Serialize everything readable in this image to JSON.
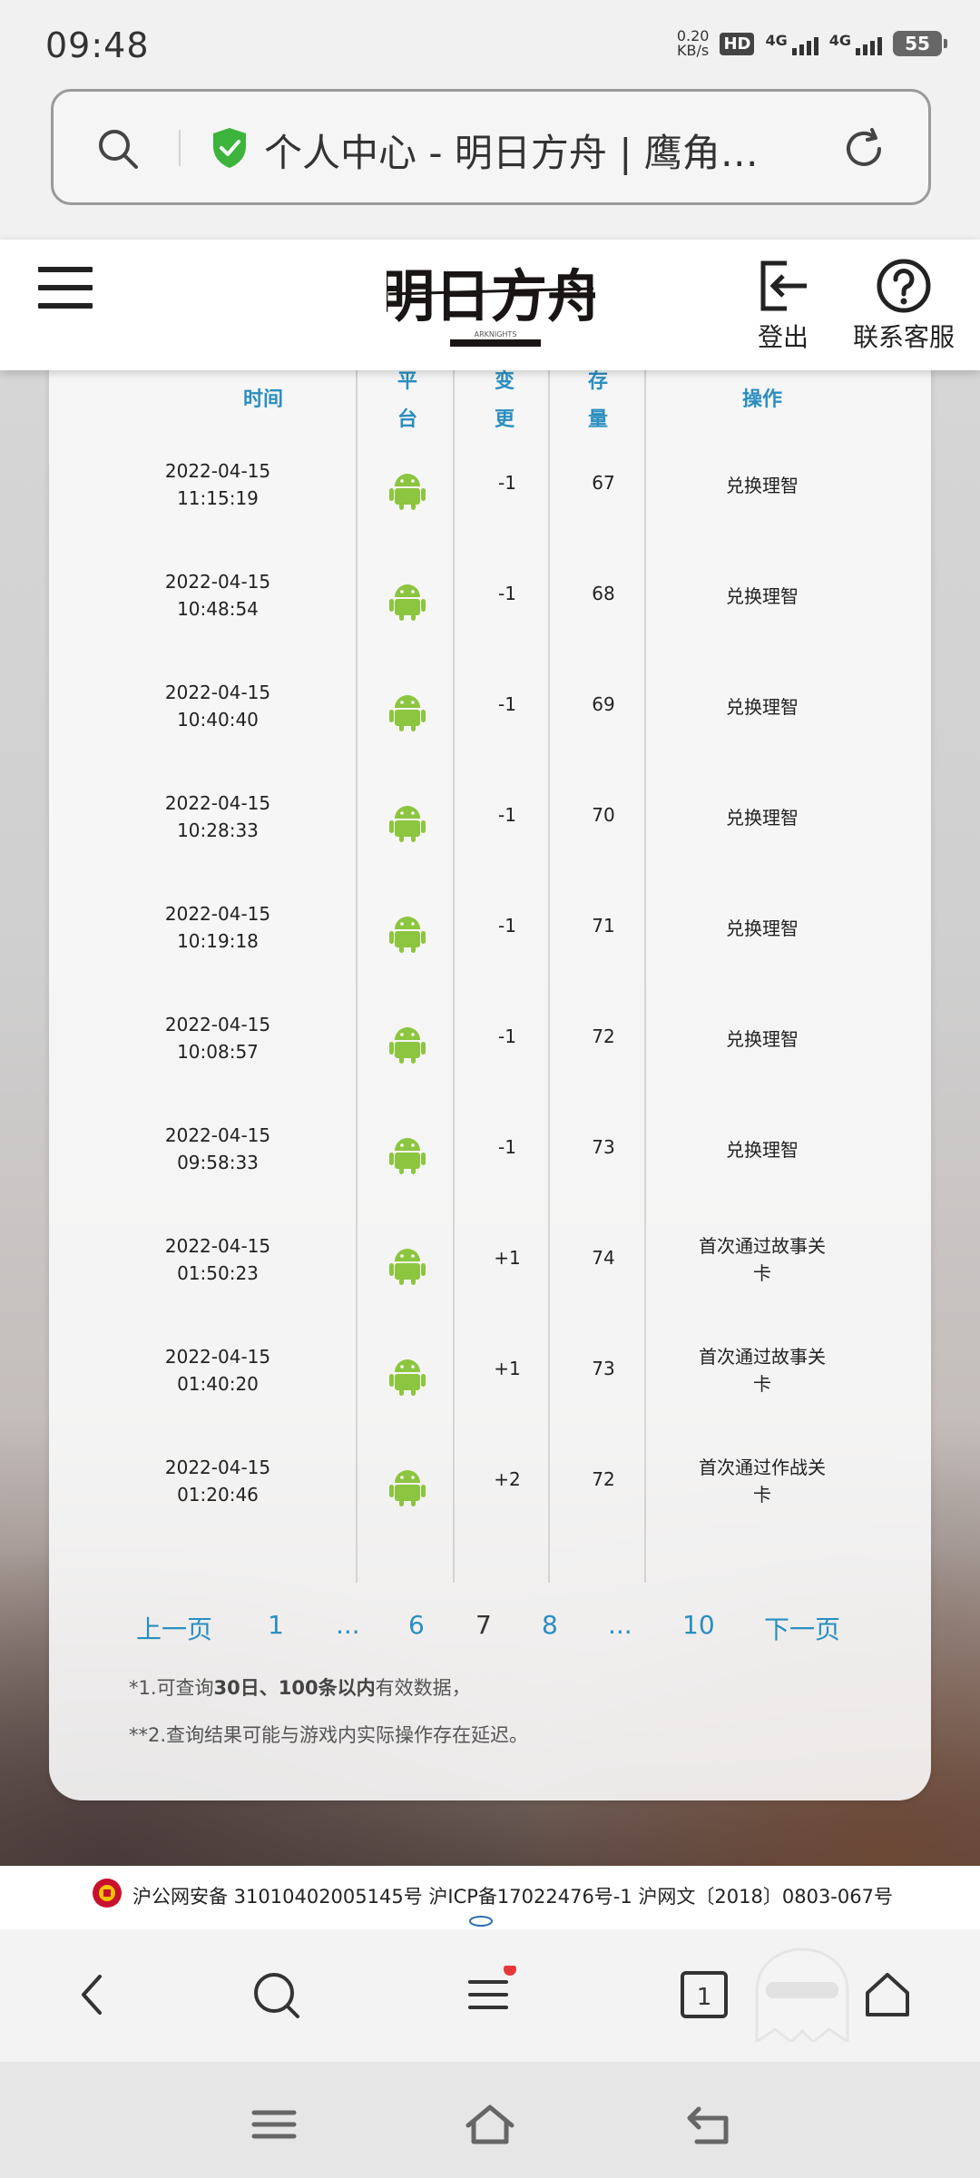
{
  "status_bar": {
    "time": "09:48",
    "net_speed_value": "0.20",
    "net_speed_unit": "KB/s",
    "hd_label": "HD",
    "sim1_label": "4G",
    "sim2_label": "4G",
    "battery": "55"
  },
  "address_bar": {
    "page_title": "个人中心 - 明日方舟 | 鹰角…",
    "secure_color": "#3cb43c"
  },
  "site_header": {
    "logo_text": "明日方舟",
    "logo_sub": "ARKNIGHTS",
    "logout_label": "登出",
    "service_label": "联系客服"
  },
  "table": {
    "headers": {
      "time": "时间",
      "platform_1": "平",
      "platform_2": "台",
      "change_1": "变",
      "change_2": "更",
      "stock_1": "存",
      "stock_2": "量",
      "action": "操作"
    },
    "platform_icon": "android-icon",
    "platform_color": "#8cc53f",
    "rows": [
      {
        "date": "2022-04-15",
        "time": "11:15:19",
        "change": "-1",
        "stock": "67",
        "action_1": "兑换理智",
        "action_2": ""
      },
      {
        "date": "2022-04-15",
        "time": "10:48:54",
        "change": "-1",
        "stock": "68",
        "action_1": "兑换理智",
        "action_2": ""
      },
      {
        "date": "2022-04-15",
        "time": "10:40:40",
        "change": "-1",
        "stock": "69",
        "action_1": "兑换理智",
        "action_2": ""
      },
      {
        "date": "2022-04-15",
        "time": "10:28:33",
        "change": "-1",
        "stock": "70",
        "action_1": "兑换理智",
        "action_2": ""
      },
      {
        "date": "2022-04-15",
        "time": "10:19:18",
        "change": "-1",
        "stock": "71",
        "action_1": "兑换理智",
        "action_2": ""
      },
      {
        "date": "2022-04-15",
        "time": "10:08:57",
        "change": "-1",
        "stock": "72",
        "action_1": "兑换理智",
        "action_2": ""
      },
      {
        "date": "2022-04-15",
        "time": "09:58:33",
        "change": "-1",
        "stock": "73",
        "action_1": "兑换理智",
        "action_2": ""
      },
      {
        "date": "2022-04-15",
        "time": "01:50:23",
        "change": "+1",
        "stock": "74",
        "action_1": "首次通过故事关",
        "action_2": "卡"
      },
      {
        "date": "2022-04-15",
        "time": "01:40:20",
        "change": "+1",
        "stock": "73",
        "action_1": "首次通过故事关",
        "action_2": "卡"
      },
      {
        "date": "2022-04-15",
        "time": "01:20:46",
        "change": "+2",
        "stock": "72",
        "action_1": "首次通过作战关",
        "action_2": "卡"
      }
    ]
  },
  "pagination": {
    "prev": "上一页",
    "p1": "1",
    "ellipsis_1": "...",
    "p6": "6",
    "current": "7",
    "p8": "8",
    "ellipsis_2": "...",
    "p10": "10",
    "next": "下一页"
  },
  "notes": {
    "n1_prefix": "*1.可查询",
    "n1_bold": "30日、100条以内",
    "n1_suffix": "有效数据，",
    "n2": "**2.查询结果可能与游戏内实际操作存在延迟。"
  },
  "footer": {
    "text": "沪公网安备 31010402005145号  沪ICP备17022476号-1  沪网文〔2018〕0803-067号"
  },
  "toolbar": {
    "tab_count": "1",
    "notification_color": "#e8373a"
  }
}
